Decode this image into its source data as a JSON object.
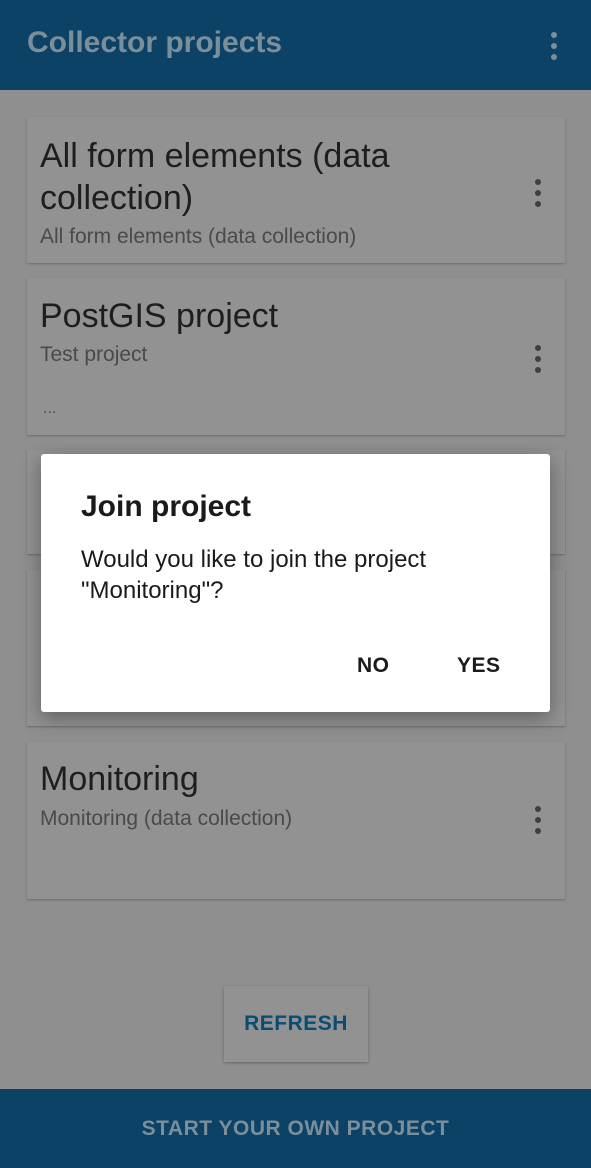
{
  "appbar": {
    "title": "Collector projects",
    "menu_icon": "more-vert-icon"
  },
  "projects": [
    {
      "title_line1": "All form elements (data",
      "title_line2": "collection)",
      "subtitle": "All form elements (data collection)"
    },
    {
      "title": "PostGIS project",
      "subtitle": "Test project",
      "extra": "..."
    },
    {
      "title": "Monitoring",
      "subtitle": "Monitoring (data collection)"
    }
  ],
  "dialog": {
    "title": "Join project",
    "message": "Would you like to join the project \"Monitoring\"?",
    "no_label": "NO",
    "yes_label": "YES"
  },
  "refresh_label": "REFRESH",
  "bottom_action_label": "START YOUR OWN PROJECT",
  "colors": {
    "primary": "#0b4265",
    "accent": "#0a4c72",
    "scrim_background": "#8f8f8f",
    "dialog_background": "#ffffff"
  }
}
